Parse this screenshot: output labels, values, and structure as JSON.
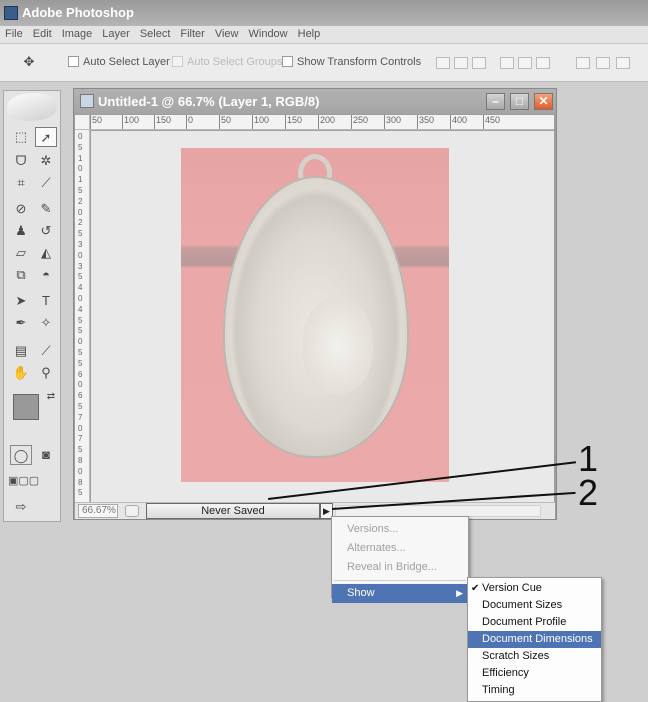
{
  "app": {
    "title": "Adobe Photoshop"
  },
  "menubar": [
    "File",
    "Edit",
    "Image",
    "Layer",
    "Select",
    "Filter",
    "View",
    "Window",
    "Help"
  ],
  "options": {
    "auto_select_layer": "Auto Select Layer",
    "auto_select_groups": "Auto Select Groups",
    "show_transform": "Show Transform Controls"
  },
  "document": {
    "title": "Untitled-1 @ 66.7% (Layer 1, RGB/8)",
    "ruler_h": [
      "50",
      "100",
      "150",
      "0",
      "50",
      "100",
      "150",
      "200",
      "250",
      "300",
      "350",
      "400",
      "450"
    ],
    "ruler_v": [
      "0",
      "5",
      "1",
      "0",
      "1",
      "5",
      "2",
      "0",
      "2",
      "5",
      "3",
      "0",
      "3",
      "5",
      "4",
      "0",
      "4",
      "5",
      "5",
      "0",
      "5",
      "5",
      "6",
      "0",
      "6",
      "5",
      "7",
      "0",
      "7",
      "5",
      "8",
      "0",
      "8",
      "5"
    ],
    "zoom": "66.67%",
    "status": "Never Saved"
  },
  "callouts": {
    "one": "1",
    "two": "2"
  },
  "status_menu": {
    "items": [
      "Versions...",
      "Alternates...",
      "Reveal in Bridge..."
    ],
    "show": "Show"
  },
  "show_submenu": {
    "items": [
      "Version Cue",
      "Document Sizes",
      "Document Profile",
      "Document Dimensions",
      "Scratch Sizes",
      "Efficiency",
      "Timing"
    ],
    "checked": "Version Cue",
    "highlighted": "Document Dimensions"
  },
  "colors": {
    "accent": "#4e74b4",
    "photo_bg": "#eaa8a8"
  },
  "icons": [
    "move-tool-icon",
    "marquee-icon",
    "lasso-icon",
    "magic-wand-icon",
    "crop-icon",
    "eyedropper-icon",
    "brush-icon",
    "stamp-icon",
    "eraser-icon",
    "bucket-icon",
    "pen-icon",
    "type-icon",
    "hand-icon",
    "zoom-icon"
  ]
}
